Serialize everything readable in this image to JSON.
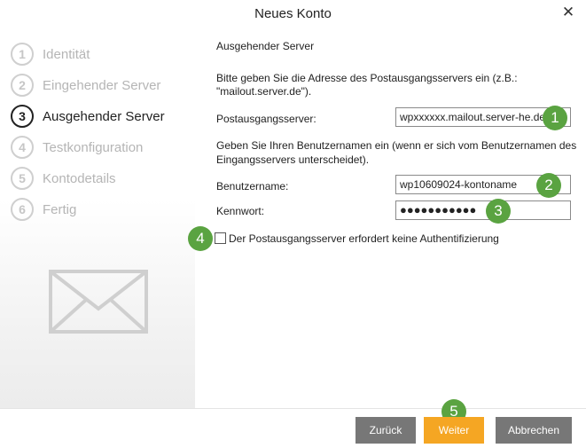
{
  "window": {
    "title": "Neues Konto",
    "close_symbol": "✕"
  },
  "steps": [
    {
      "num": "1",
      "label": "Identität"
    },
    {
      "num": "2",
      "label": "Eingehender Server"
    },
    {
      "num": "3",
      "label": "Ausgehender Server"
    },
    {
      "num": "4",
      "label": "Testkonfiguration"
    },
    {
      "num": "5",
      "label": "Kontodetails"
    },
    {
      "num": "6",
      "label": "Fertig"
    }
  ],
  "active_step": 3,
  "form": {
    "heading": "Ausgehender Server",
    "intro_line1": "Bitte geben Sie die Adresse des Postausgangsservers ein (z.B.:",
    "intro_line2": "\"mailout.server.de\").",
    "server_label": "Postausgangsserver:",
    "server_value": "wpxxxxxx.mailout.server-he.de",
    "username_hint_line1": "Geben Sie Ihren Benutzernamen ein (wenn er sich vom Benutzernamen des",
    "username_hint_line2": "Eingangsservers unterscheidet).",
    "username_label": "Benutzername:",
    "username_value": "wp10609024-kontoname",
    "password_label": "Kennwort:",
    "password_value": "●●●●●●●●●●●",
    "noauth_label": "Der Postausgangsserver erfordert keine Authentifizierung",
    "noauth_checked": false
  },
  "badges": [
    "1",
    "2",
    "3",
    "4",
    "5"
  ],
  "buttons": {
    "back": "Zurück",
    "next": "Weiter",
    "cancel": "Abbrechen"
  },
  "colors": {
    "accent": "#f5a623",
    "badge": "#5aa341",
    "button_gray": "#777777"
  },
  "icons": {
    "sidebar_image": "envelope-icon"
  }
}
